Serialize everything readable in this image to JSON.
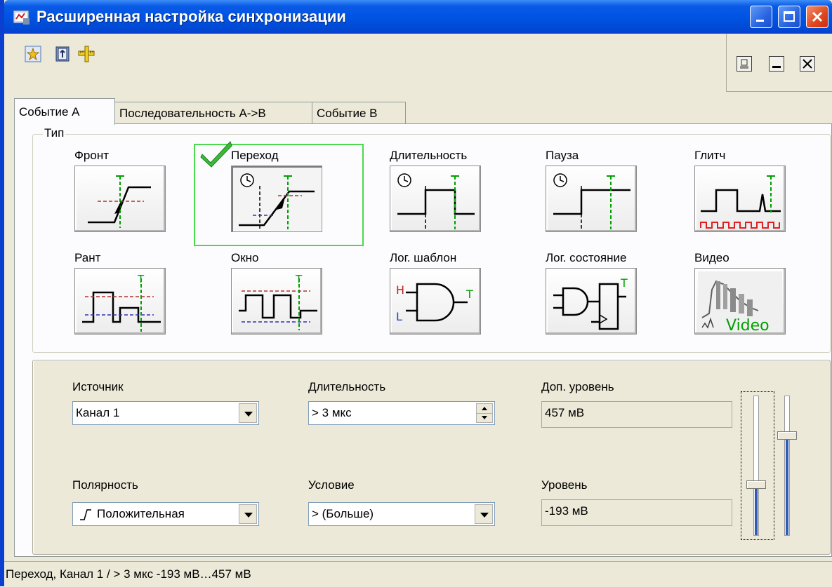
{
  "window": {
    "title": "Расширенная настройка синхронизации"
  },
  "tabs": [
    {
      "label": "Событие А"
    },
    {
      "label": "Последовательность А->В"
    },
    {
      "label": "Событие В"
    }
  ],
  "trigger_group": {
    "label": "Тип",
    "types": [
      {
        "label": "Фронт",
        "icon": "edge-trigger-icon"
      },
      {
        "label": "Переход",
        "icon": "transition-trigger-icon",
        "selected": true
      },
      {
        "label": "Длительность",
        "icon": "duration-trigger-icon"
      },
      {
        "label": "Пауза",
        "icon": "pause-trigger-icon"
      },
      {
        "label": "Глитч",
        "icon": "glitch-trigger-icon"
      },
      {
        "label": "Рант",
        "icon": "runt-trigger-icon"
      },
      {
        "label": "Окно",
        "icon": "window-trigger-icon"
      },
      {
        "label": "Лог. шаблон",
        "icon": "logic-pattern-icon"
      },
      {
        "label": "Лог. состояние",
        "icon": "logic-state-icon"
      },
      {
        "label": "Видео",
        "icon": "video-trigger-icon"
      }
    ],
    "icon_text": {
      "h": "H",
      "l": "L",
      "t": "T",
      "video": "Video"
    }
  },
  "settings": {
    "source": {
      "label": "Источник",
      "value": "Канал 1"
    },
    "duration": {
      "label": "Длительность",
      "value": "> 3 мкс"
    },
    "aux_level": {
      "label": "Доп. уровень",
      "value": "457 мВ"
    },
    "polarity": {
      "label": "Полярность",
      "value": "Положительная"
    },
    "condition": {
      "label": "Условие",
      "value": "> (Больше)"
    },
    "level": {
      "label": "Уровень",
      "value": "-193 мВ"
    },
    "slider_left_fraction": 0.36,
    "slider_right_fraction": 0.72
  },
  "status": {
    "text": "Переход, Канал 1 / > 3 мкс -193 мВ…457 мВ"
  },
  "colors": {
    "title_bar": "#0054e3",
    "selection": "#4cd84c",
    "trigger_marker": "#00a000",
    "level_red": "#b03030",
    "level_blue": "#3030b0"
  }
}
